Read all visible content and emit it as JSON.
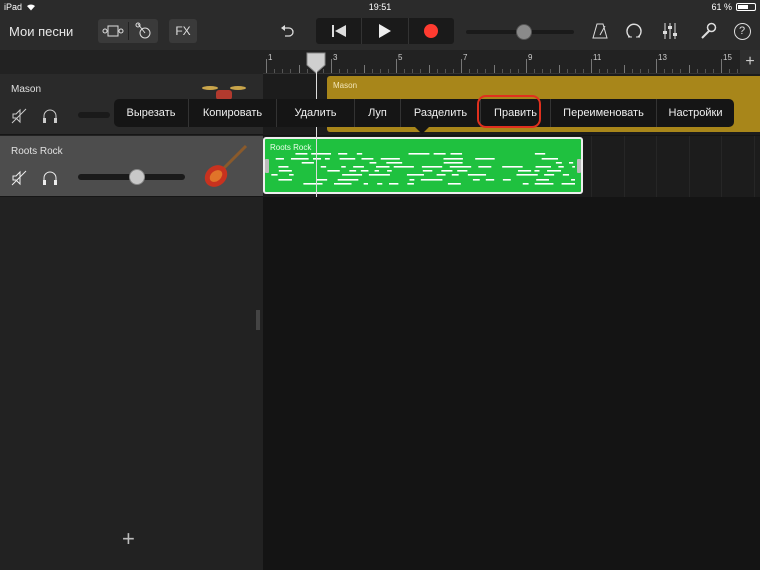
{
  "status": {
    "device": "iPad",
    "time": "19:51",
    "battery": "61 %",
    "battery_level": 0.61
  },
  "toolbar": {
    "title": "Мои песни",
    "fx_label": "FX",
    "icons": [
      "track-view-icon",
      "browser-icon",
      "undo-icon",
      "rewind-icon",
      "play-icon",
      "record-icon",
      "metronome-icon",
      "loop-browser-icon",
      "mixer-icon",
      "settings-wrench-icon",
      "help-icon"
    ],
    "help_label": "?",
    "master_volume": 0.55
  },
  "ruler": {
    "bars": [
      "1",
      "3",
      "5",
      "7",
      "9",
      "11",
      "13",
      "15"
    ],
    "add_label": "+"
  },
  "tracks": [
    {
      "name": "Mason",
      "instrument": "drums",
      "volume": 0.5
    },
    {
      "name": "Roots Rock",
      "instrument": "electric-guitar",
      "volume": 0.55
    }
  ],
  "regions": {
    "mason": "Mason",
    "roots": "Roots Rock"
  },
  "add_track_label": "+",
  "context_menu": {
    "items": [
      "Вырезать",
      "Копировать",
      "Удалить",
      "Луп",
      "Разделить",
      "Править",
      "Переименовать",
      "Настройки"
    ],
    "highlighted": "Править"
  },
  "colors": {
    "accent_record": "#ff3b30",
    "mason_region": "#a8861a",
    "roots_region": "#1fc13f",
    "highlight_ring": "#e0301e"
  }
}
